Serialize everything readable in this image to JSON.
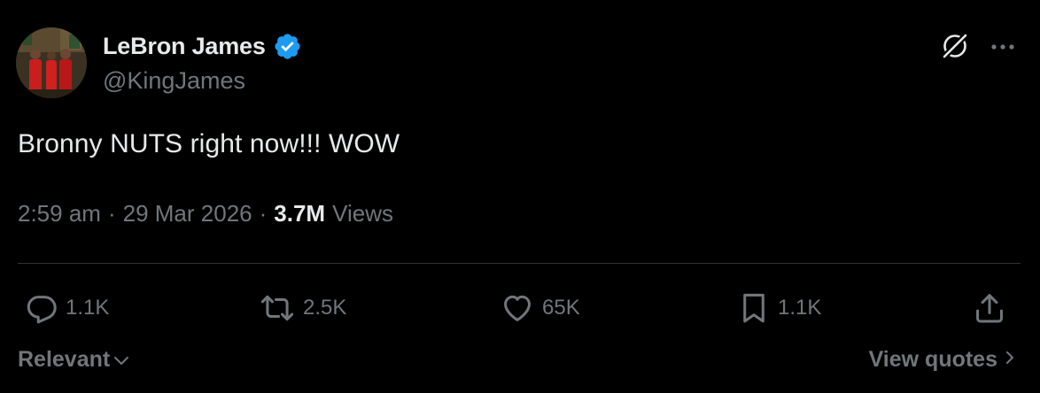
{
  "author": {
    "name": "LeBron James",
    "handle": "@KingJames",
    "verified": true
  },
  "tweet": {
    "text": "Bronny NUTS right now!!! WOW",
    "time": "2:59 am",
    "date": "29 Mar 2026",
    "separator": "·",
    "views_count": "3.7M",
    "views_label": "Views"
  },
  "actions": {
    "replies": "1.1K",
    "reposts": "2.5K",
    "likes": "65K",
    "bookmarks": "1.1K"
  },
  "footer": {
    "sort_label": "Relevant",
    "view_quotes_label": "View quotes"
  },
  "icons": {
    "verified": "verified-badge-icon",
    "grok": "grok-icon",
    "more": "more-icon",
    "reply": "reply-icon",
    "repost": "repost-icon",
    "like": "heart-icon",
    "bookmark": "bookmark-icon",
    "share": "share-icon"
  },
  "colors": {
    "background": "#000000",
    "text_primary": "#e7e9ea",
    "text_secondary": "#71767b",
    "divider": "#2f3336",
    "verified_blue": "#1d9bf0"
  }
}
